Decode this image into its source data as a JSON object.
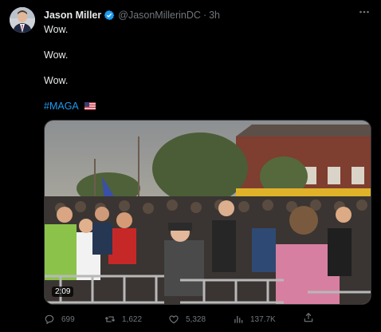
{
  "author": {
    "name": "Jason Miller",
    "handle": "@JasonMillerinDC",
    "time": "3h"
  },
  "tweet": {
    "lines": [
      "Wow.",
      "Wow.",
      "Wow."
    ],
    "hashtag": "#MAGA"
  },
  "media": {
    "duration": "2:09"
  },
  "actions": {
    "replies": "699",
    "retweets": "1,622",
    "likes": "5,328",
    "views": "137.7K"
  },
  "colors": {
    "background": "#000000",
    "text": "#e7e9ea",
    "muted": "#71767b",
    "accent": "#1d9bf0"
  },
  "icons": [
    "verified-badge-icon",
    "more-icon",
    "reply-icon",
    "retweet-icon",
    "like-icon",
    "views-icon",
    "share-icon",
    "us-flag-icon"
  ]
}
